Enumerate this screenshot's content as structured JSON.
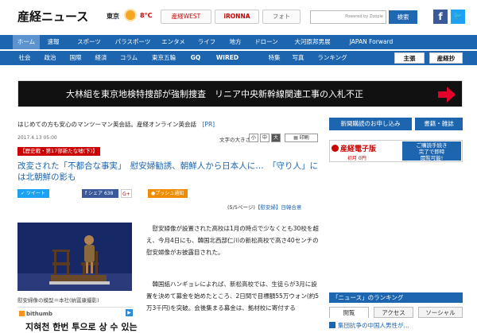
{
  "header": {
    "logo": "産経ニュース",
    "city": "東京",
    "weather_icon": "sunny-icon",
    "temp": "8°C",
    "links": [
      "産経WEST",
      "iRONNA",
      "フォト"
    ],
    "search": {
      "value": "",
      "powered": "Powered by Zoople",
      "button": "検索"
    },
    "social": {
      "facebook": "f",
      "twitter": "🐦"
    }
  },
  "nav_primary": [
    "ホーム",
    "速報",
    "スポーツ",
    "パラスポーツ",
    "エンタメ",
    "ライフ",
    "地方",
    "ドローン",
    "大河原邦男展",
    "JAPAN Forward"
  ],
  "nav_secondary": [
    "社会",
    "政治",
    "国際",
    "経済",
    "コラム",
    "東京五輪",
    "GQ",
    "WIRED",
    "特集",
    "写真",
    "ランキング"
  ],
  "nav_secondary_buttons": [
    "主張",
    "産経抄"
  ],
  "banner": {
    "text": "大林組を東京地検特捜部が強制捜査　リニア中央新幹線関連工事の入札不正"
  },
  "promo_line": {
    "text": "はじめての方も安心のマンツーマン英会話。産経オンライン英会話",
    "tag": "[PR]"
  },
  "article": {
    "date": "2017.4.13 05:00",
    "text_size_label": "文字の大きさ",
    "text_sizes": [
      "小",
      "中",
      "大"
    ],
    "print": "印刷",
    "category": "【歴史戦・第17部新たな嘘(下)】",
    "headline": "改変された「不都合な事実」　慰安婦勧誘、朝鮮人から日本人に…　「守り人」には北朝鮮の影も",
    "share": {
      "tweet": "ツイート",
      "facebook": "シェア 638",
      "gplus": "G+",
      "push": "プッシュ通知"
    },
    "page_info": "(5/5ページ)",
    "page_tag": "【慰安婦】",
    "page_tag2": "日韓合意",
    "photo_caption": "慰安婦像の模型＝本社(納冨康撮影)",
    "paragraphs": [
      "　慰安婦像が設置された高校は1月の時点で少なくとも30校を超え、今月4日にも、韓国北西部仁川の新松高校で高さ40センチの慰安婦像がお披露目された。",
      "　韓国紙ハンギョレによれば、新松高校では、生徒らが3月に設置を決めて募金を始めたところ、2日間で目標額55万ウォン(約5万3千円)を突破。会後集まる募金は、拠材校に寄付する"
    ]
  },
  "ad": {
    "brand": "bithumb",
    "text": "지혀천 한번 투으로 상 수 있는"
  },
  "sidebar": {
    "buttons": [
      "新聞購読のお申し込み",
      "書籍・雑誌"
    ],
    "ad": {
      "title": "産経電子版",
      "sub": "初月 0円",
      "box": [
        "ご購読手続き",
        "完了で即時",
        "閲覧可能!"
      ]
    },
    "ranking_title": "「ニュース」のランキング",
    "tabs": [
      "閲覧",
      "アクセス",
      "ソーシャル"
    ],
    "first_item": "集団抗争の中国人男性が…"
  }
}
